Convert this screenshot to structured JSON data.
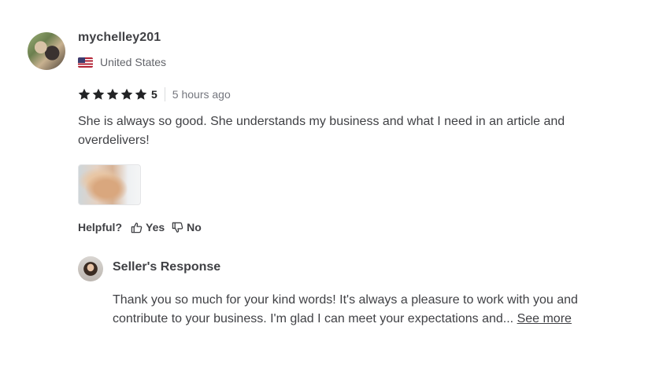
{
  "review": {
    "username": "mychelley201",
    "country": "United States",
    "rating": "5",
    "time_ago": "5 hours ago",
    "text": "She is always so good. She understands my business and what I need in an article and overdelivers!",
    "stars_filled": 5,
    "icons": [
      "avatar",
      "us-flag-icon",
      "star-icon",
      "thumbs-up-icon",
      "thumbs-down-icon"
    ],
    "helpful": {
      "label": "Helpful?",
      "yes": "Yes",
      "no": "No"
    }
  },
  "seller_response": {
    "title": "Seller's Response",
    "text": "Thank you so much for your kind words! It's always a pleasure to work with you and contribute to your business. I'm glad I can meet your expectations and...",
    "see_more": "See more"
  },
  "colors": {
    "text": "#404145",
    "muted": "#62646a",
    "star": "#222325"
  }
}
